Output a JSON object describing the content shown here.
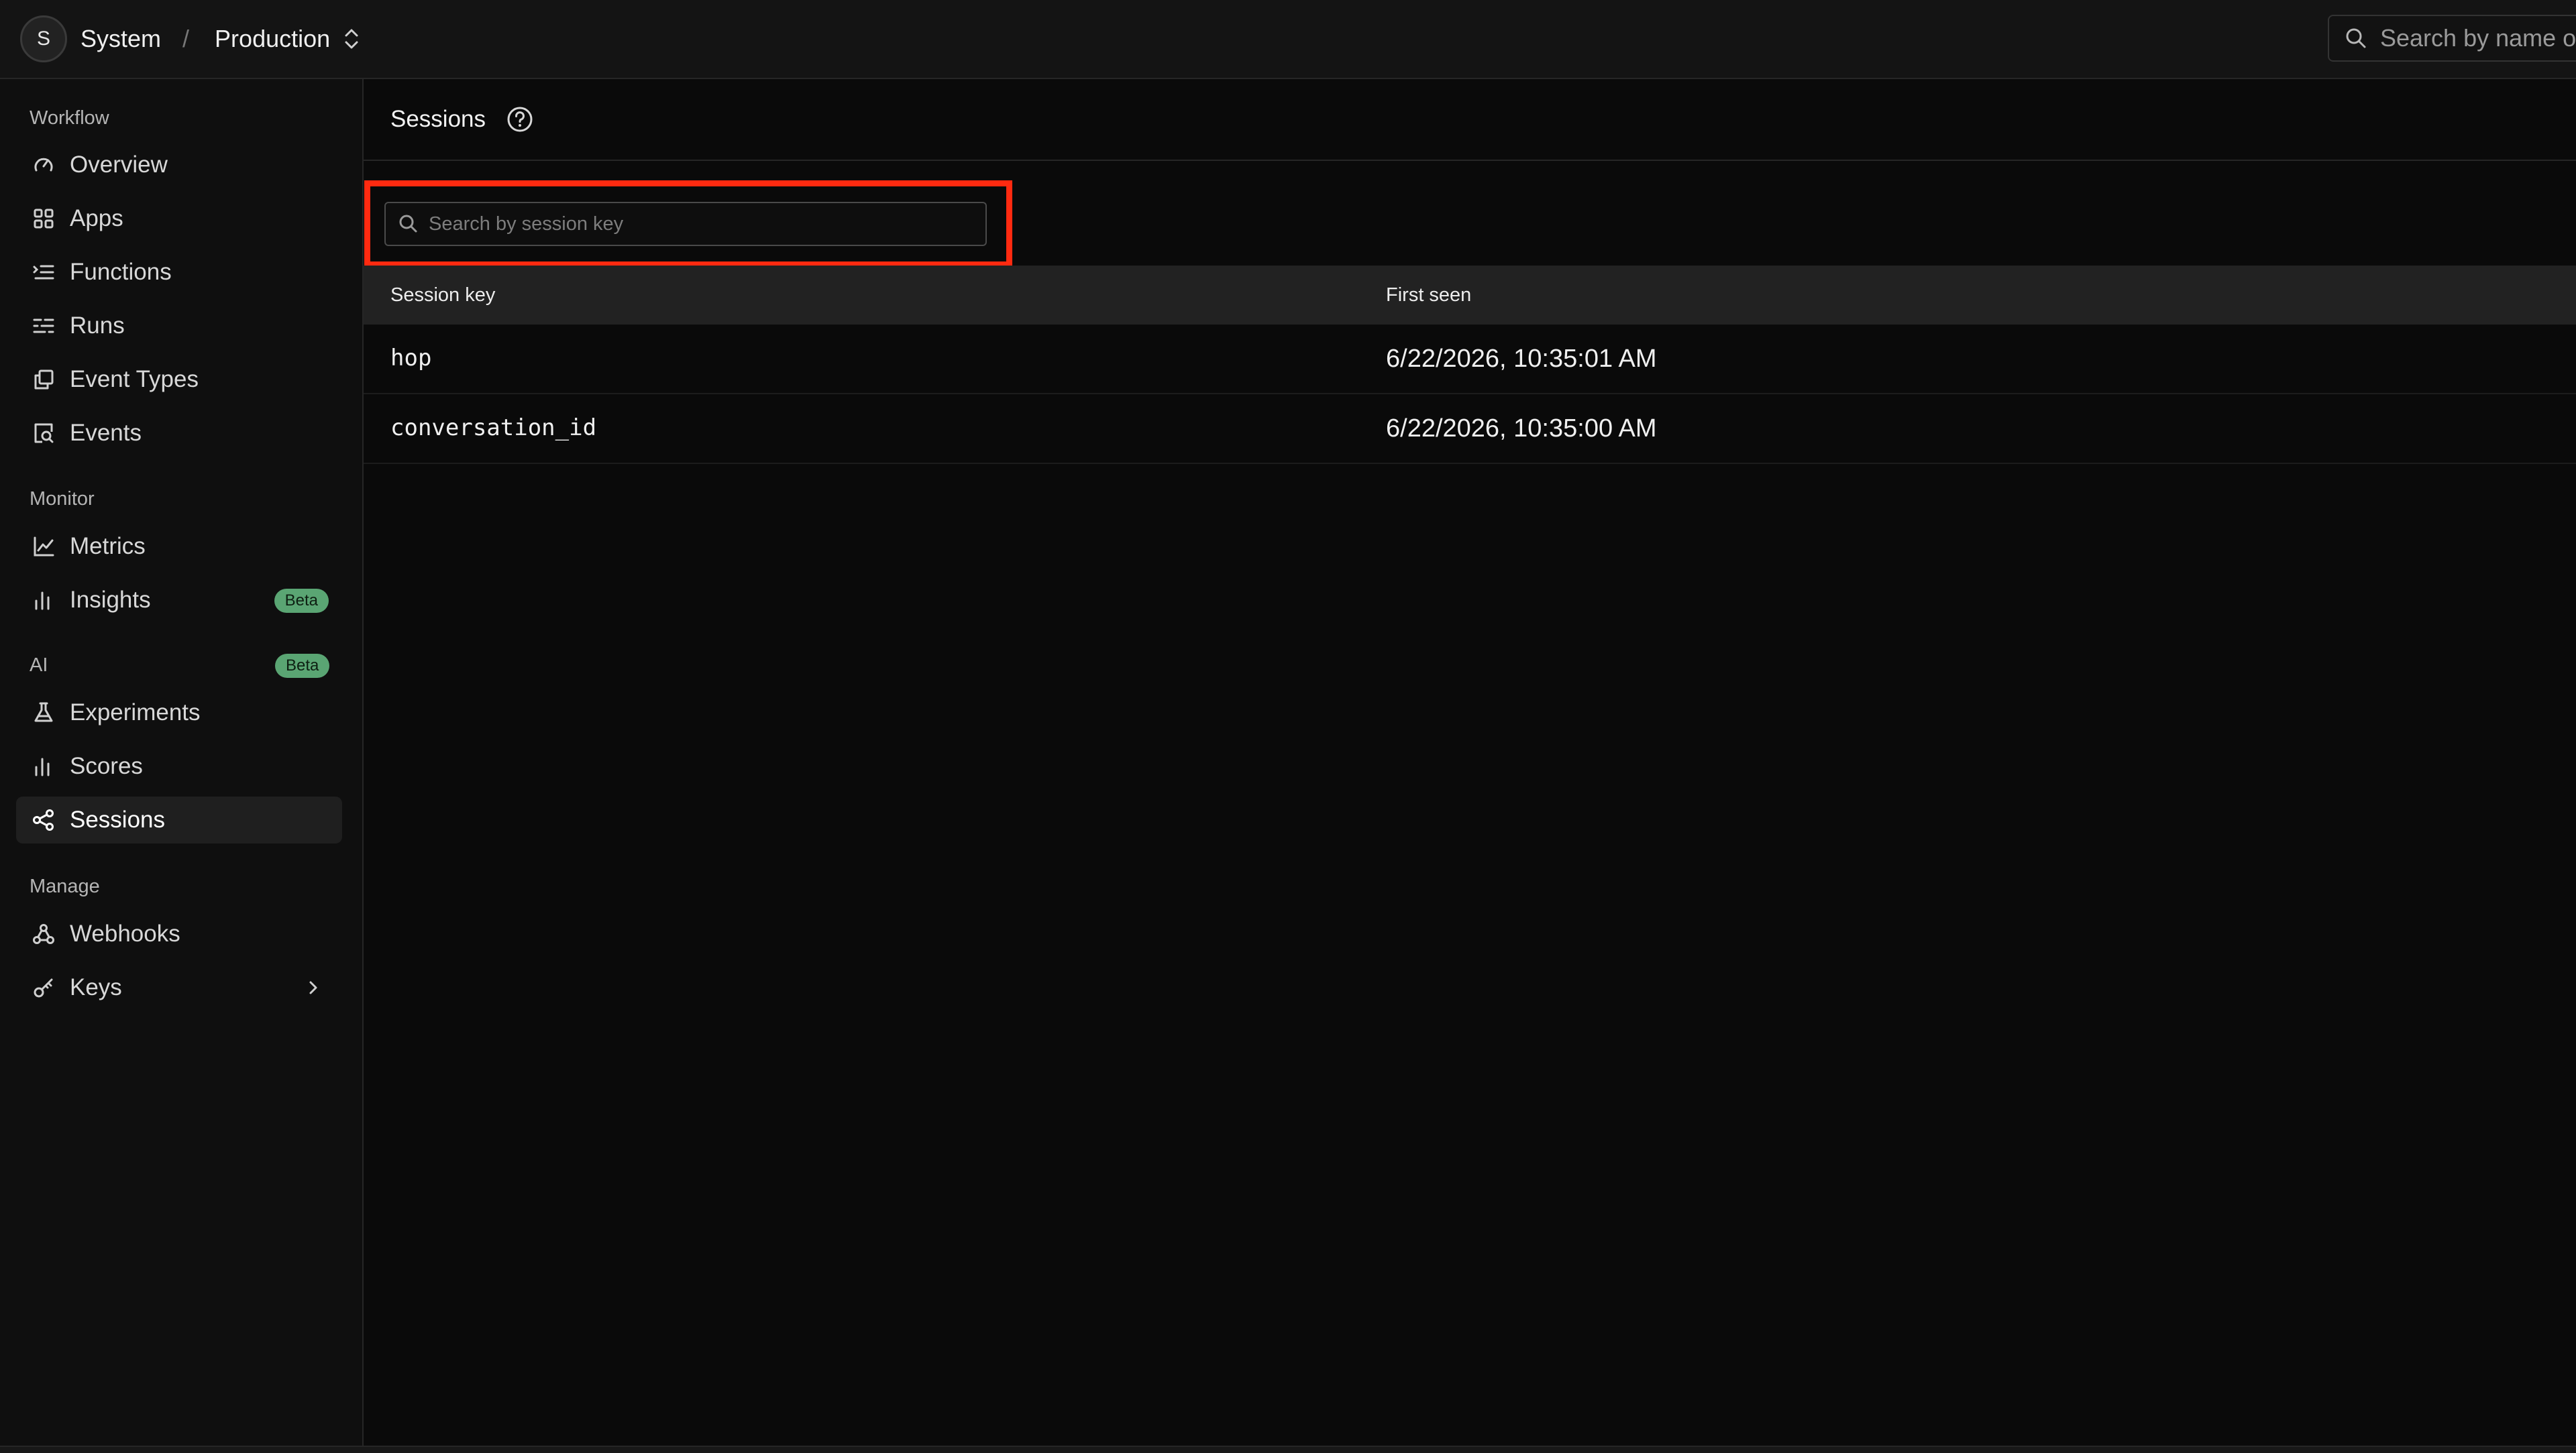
{
  "topbar": {
    "avatar_initial": "S",
    "org_name": "System",
    "separator": "/",
    "environment": "Production",
    "search_placeholder": "Search by name or"
  },
  "sidebar": {
    "sections": {
      "workflow": "Workflow",
      "monitor": "Monitor",
      "ai": "AI",
      "ai_badge": "Beta",
      "manage": "Manage"
    },
    "items": [
      {
        "label": "Overview",
        "icon": "gauge-icon"
      },
      {
        "label": "Apps",
        "icon": "grid-icon"
      },
      {
        "label": "Functions",
        "icon": "list-indent-icon"
      },
      {
        "label": "Runs",
        "icon": "runs-list-icon"
      },
      {
        "label": "Event Types",
        "icon": "copy-icon"
      },
      {
        "label": "Events",
        "icon": "search-doc-icon"
      },
      {
        "label": "Metrics",
        "icon": "line-chart-icon"
      },
      {
        "label": "Insights",
        "icon": "bar-chart-icon",
        "badge": "Beta"
      },
      {
        "label": "Experiments",
        "icon": "flask-icon"
      },
      {
        "label": "Scores",
        "icon": "bar-chart-icon"
      },
      {
        "label": "Sessions",
        "icon": "share-nodes-icon",
        "active": true
      },
      {
        "label": "Webhooks",
        "icon": "webhook-icon"
      },
      {
        "label": "Keys",
        "icon": "key-icon"
      }
    ]
  },
  "main": {
    "title": "Sessions",
    "search_placeholder": "Search by session key",
    "search_value": "",
    "table": {
      "columns": [
        "Session key",
        "First seen"
      ],
      "rows": [
        {
          "key": "hop",
          "first_seen": "6/22/2026, 10:35:01 AM"
        },
        {
          "key": "conversation_id",
          "first_seen": "6/22/2026, 10:35:00 AM"
        }
      ]
    }
  },
  "colors": {
    "background": "#0a0a0a",
    "sidebar": "#0f0f0f",
    "highlight": "#ff2a10",
    "badge": "#5aa573"
  }
}
